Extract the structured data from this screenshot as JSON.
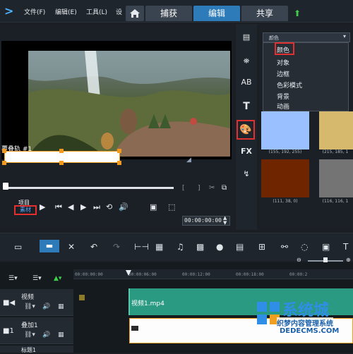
{
  "menu": {
    "file": "文件(F)",
    "edit": "编辑(E)",
    "tools": "工具(L)",
    "settings": "设"
  },
  "workspace_tabs": [
    {
      "label": "捕获",
      "active": false
    },
    {
      "label": "编辑",
      "active": true
    },
    {
      "label": "共享",
      "active": false
    }
  ],
  "preview": {
    "overlay_track_label": "覆叠轨 #1",
    "project_label": "项目",
    "clip_label": "素材",
    "timecode": "00:00:00:00"
  },
  "side_tools": {
    "fx_label": "FX"
  },
  "library": {
    "dropdown_label": "颜色",
    "dropdown_items": [
      "颜色",
      "对象",
      "边框",
      "色彩模式",
      "背景",
      "动画"
    ],
    "swatches": [
      {
        "label": "(155, 192, 255)",
        "color": "#9BC0FF"
      },
      {
        "label": "(215, 185, 1",
        "color": "#D7B96E"
      },
      {
        "label": "(111, 38, 0)",
        "color": "#6F2600"
      },
      {
        "label": "(116, 116, 1",
        "color": "#747474"
      }
    ]
  },
  "timeline": {
    "ruler_ticks": [
      "00:00:00:00",
      "00:00:06:00",
      "00:00:12:00",
      "00:00:18:00",
      "00:00:2"
    ],
    "tracks": [
      {
        "name": "视频"
      },
      {
        "name": "叠加1"
      },
      {
        "name": "标题1"
      }
    ],
    "video_clip_name": "视频1.mp4"
  },
  "watermark": {
    "brand": "系统城",
    "site": "DEDECMS.COM",
    "sub": "织梦内容管理系统"
  },
  "colors": {
    "accent": "#2d7bb8",
    "highlight_box": "#e23030",
    "video_clip": "#2b9a83",
    "overlay_border": "#f0a020"
  }
}
